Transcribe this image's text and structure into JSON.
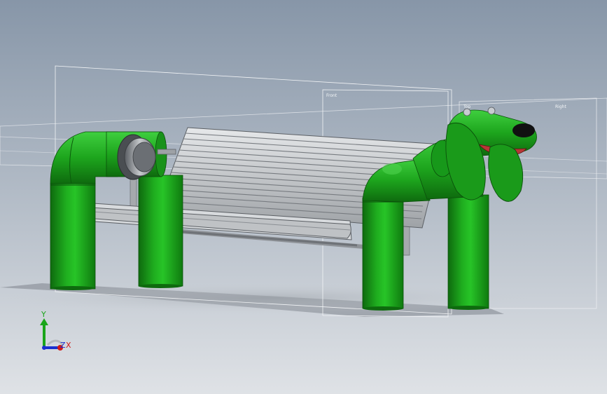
{
  "viewport": {
    "background_top": "#8796a8",
    "background_bottom": "#dfe2e6"
  },
  "model": {
    "body_color": "#1c9a1c",
    "body_highlight": "#4fd24f",
    "body_shadow": "#0e6a0e",
    "metal_color": "#b9bcc0",
    "metal_shadow": "#6f7378",
    "tongue_color": "#b83636",
    "nose_color": "#111111",
    "eye_color": "#c8ccd0"
  },
  "planes": {
    "front": "Front",
    "top": "Top",
    "right": "Right"
  },
  "triad": {
    "y_label": "Y",
    "z_label": "Z",
    "x_label": "X",
    "y_color": "#1aa51a",
    "z_color": "#1a2fd0",
    "x_color": "#d01a1a"
  }
}
